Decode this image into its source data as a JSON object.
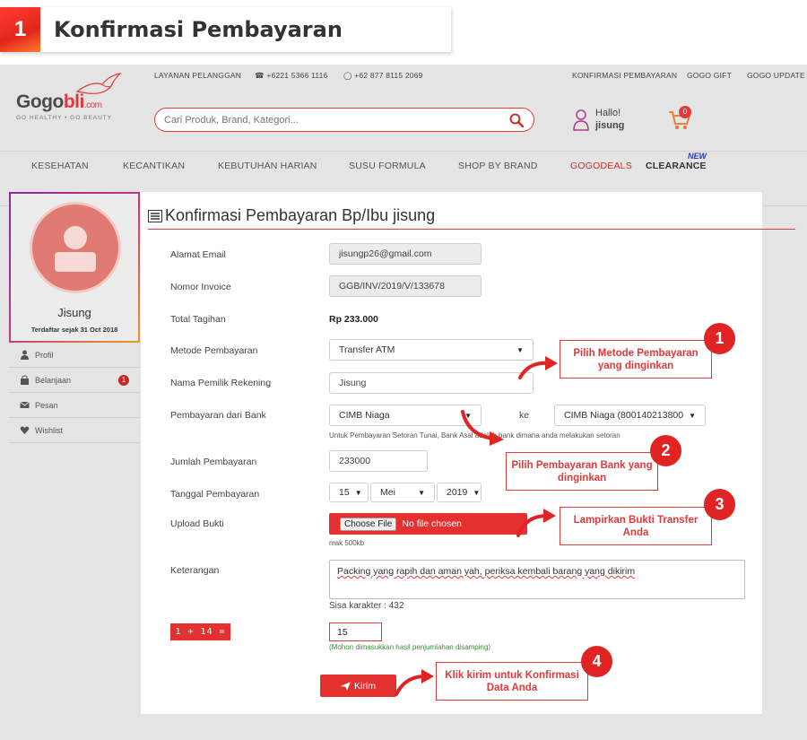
{
  "step": {
    "number": "1",
    "title": "Konfirmasi Pembayaran"
  },
  "util": {
    "cs": "LAYANAN PELANGGAN",
    "phone": "+6221 5366 1116",
    "wa": "+62 877 8115 2069",
    "konfirmasi": "KONFIRMASI PEMBAYARAN",
    "gift": "GOGO GIFT",
    "update": "GOGO UPDATE"
  },
  "logo": {
    "part1": "Gogo",
    "part2": "bli",
    "part3": ".com",
    "tagline": "GO HEALTHY • GO BEAUTY"
  },
  "search": {
    "placeholder": "Cari Produk, Brand, Kategori..."
  },
  "user": {
    "greeting": "Hallo!",
    "name": "jisung"
  },
  "cart": {
    "count": "0"
  },
  "nav": {
    "items": [
      "KESEHATAN",
      "KECANTIKAN",
      "KEBUTUHAN HARIAN",
      "SUSU FORMULA",
      "SHOP BY BRAND",
      "GOGODEALS",
      "CLEARANCE"
    ],
    "new_badge": "NEW"
  },
  "profile": {
    "name": "Jisung",
    "since": "Terdaftar sejak 31 Oct 2018"
  },
  "menu": {
    "items": [
      "Profil",
      "Belanjaan",
      "Pesan",
      "Wishlist"
    ],
    "belanjaan_badge": "1"
  },
  "form": {
    "title": "Konfirmasi Pembayaran Bp/Ibu jisung",
    "email_label": "Alamat Email",
    "email_value": "jisungp26@gmail.com",
    "invoice_label": "Nomor Invoice",
    "invoice_value": "GGB/INV/2019/V/133678",
    "total_label": "Total Tagihan",
    "total_value": "Rp 233.000",
    "method_label": "Metode Pembayaran",
    "method_value": "Transfer ATM",
    "owner_label": "Nama Pemilik Rekening",
    "owner_value": "Jisung",
    "bank_label": "Pembayaran dari Bank",
    "bank_from": "CIMB Niaga",
    "bank_to_label": "ke",
    "bank_to": "CIMB Niaga (800140213800)",
    "bank_hint": "Untuk Pembayaran Setoran Tunai, Bank Asal adalah bank dimana anda melakukan setoran",
    "amount_label": "Jumlah Pembayaran",
    "amount_value": "233000",
    "date_label": "Tanggal Pembayaran",
    "date_day": "15",
    "date_month": "Mei",
    "date_year": "2019",
    "upload_label": "Upload Bukti",
    "upload_button": "Choose File",
    "upload_status": "No file chosen",
    "upload_hint": "mak 500kb",
    "note_label": "Keterangan",
    "note_value": "Packing yang rapih dan aman yah, periksa kembali barang yang dikirim",
    "char_count": "Sisa karakter : 432",
    "captcha": "1 + 14 =",
    "captcha_answer": "15",
    "captcha_hint": "(Mohon dimasukkan hasil penjumlahan disamping)",
    "submit": "Kirim"
  },
  "callouts": {
    "c1": "Pilih Metode Pembayaran yang dinginkan",
    "c2": "Pilih Pembayaran Bank yang dinginkan",
    "c3": "Lampirkan Bukti Transfer Anda",
    "c4": "Klik kirim untuk Konfirmasi Data Anda",
    "n1": "1",
    "n2": "2",
    "n3": "3",
    "n4": "4"
  },
  "colors": {
    "accent": "#e23a3a",
    "brand_red": "#e53030",
    "bg": "#e4e4e4"
  }
}
